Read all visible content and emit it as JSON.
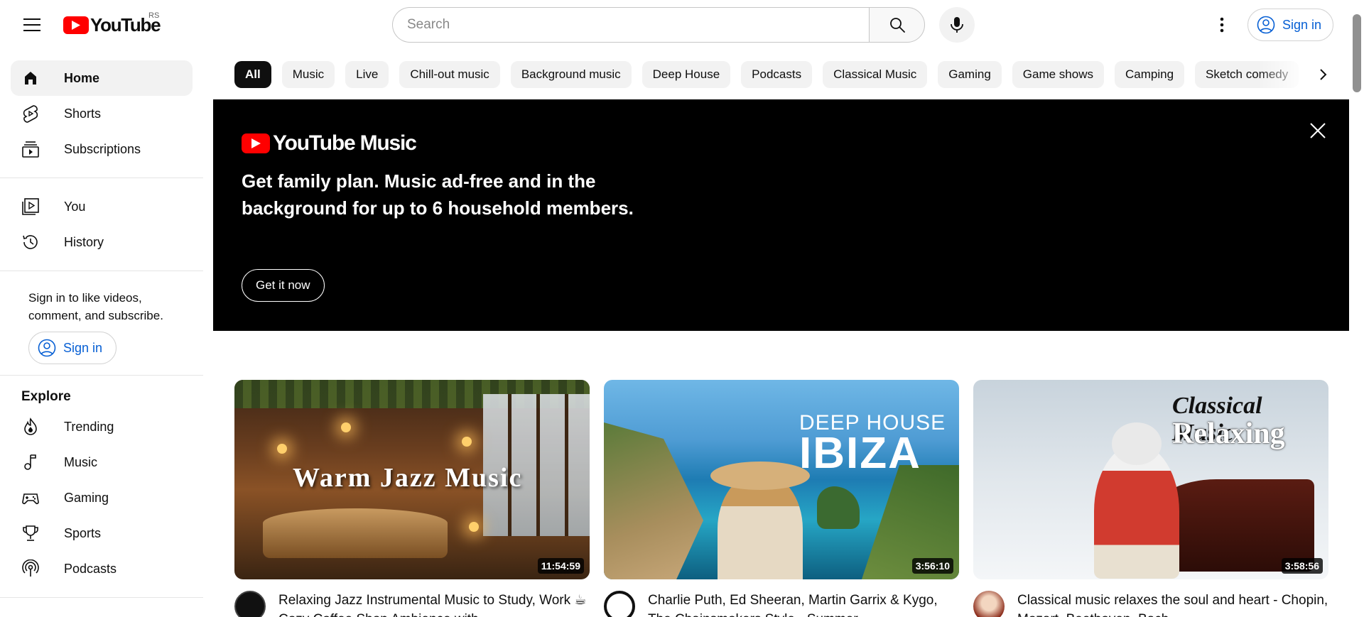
{
  "header": {
    "logo_text": "YouTube",
    "country_code": "RS",
    "search_placeholder": "Search",
    "sign_in_label": "Sign in"
  },
  "sidebar": {
    "primary": [
      {
        "label": "Home",
        "icon": "home-icon",
        "active": true
      },
      {
        "label": "Shorts",
        "icon": "shorts-icon"
      },
      {
        "label": "Subscriptions",
        "icon": "subscriptions-icon"
      }
    ],
    "you": [
      {
        "label": "You",
        "icon": "you-icon"
      },
      {
        "label": "History",
        "icon": "history-icon"
      }
    ],
    "signin_prompt": "Sign in to like videos, comment, and subscribe.",
    "signin_button": "Sign in",
    "explore_title": "Explore",
    "explore": [
      {
        "label": "Trending",
        "icon": "trending-icon"
      },
      {
        "label": "Music",
        "icon": "music-icon"
      },
      {
        "label": "Gaming",
        "icon": "gaming-icon"
      },
      {
        "label": "Sports",
        "icon": "sports-icon"
      },
      {
        "label": "Podcasts",
        "icon": "podcasts-icon"
      }
    ]
  },
  "chips": [
    "All",
    "Music",
    "Live",
    "Chill-out music",
    "Background music",
    "Deep House",
    "Podcasts",
    "Classical Music",
    "Gaming",
    "Game shows",
    "Camping",
    "Sketch comedy"
  ],
  "banner": {
    "logo_text": "YouTube Music",
    "headline": "Get family plan. Music ad-free and in the background for up to 6 household members.",
    "cta": "Get it now"
  },
  "videos": [
    {
      "title": "Relaxing Jazz Instrumental Music to Study, Work ☕ Cozy Coffee Shop Ambience with",
      "duration": "11:54:59",
      "thumb_text": "Warm Jazz Music"
    },
    {
      "title": "Charlie Puth, Ed Sheeran, Martin Garrix & Kygo, The Chainsmokers Style - Summer",
      "duration": "3:56:10",
      "thumb_text_1": "DEEP HOUSE",
      "thumb_text_2": "IBIZA"
    },
    {
      "title": "Classical music relaxes the soul and heart - Chopin, Mozart, Beethoven, Bach",
      "duration": "3:58:56",
      "thumb_text_1": "Classical Music",
      "thumb_text_2": "Relaxing"
    }
  ],
  "colors": {
    "brand_red": "#ff0000",
    "link_blue": "#065fd4",
    "chip_bg": "#f2f2f2",
    "chip_active_bg": "#0f0f0f"
  }
}
